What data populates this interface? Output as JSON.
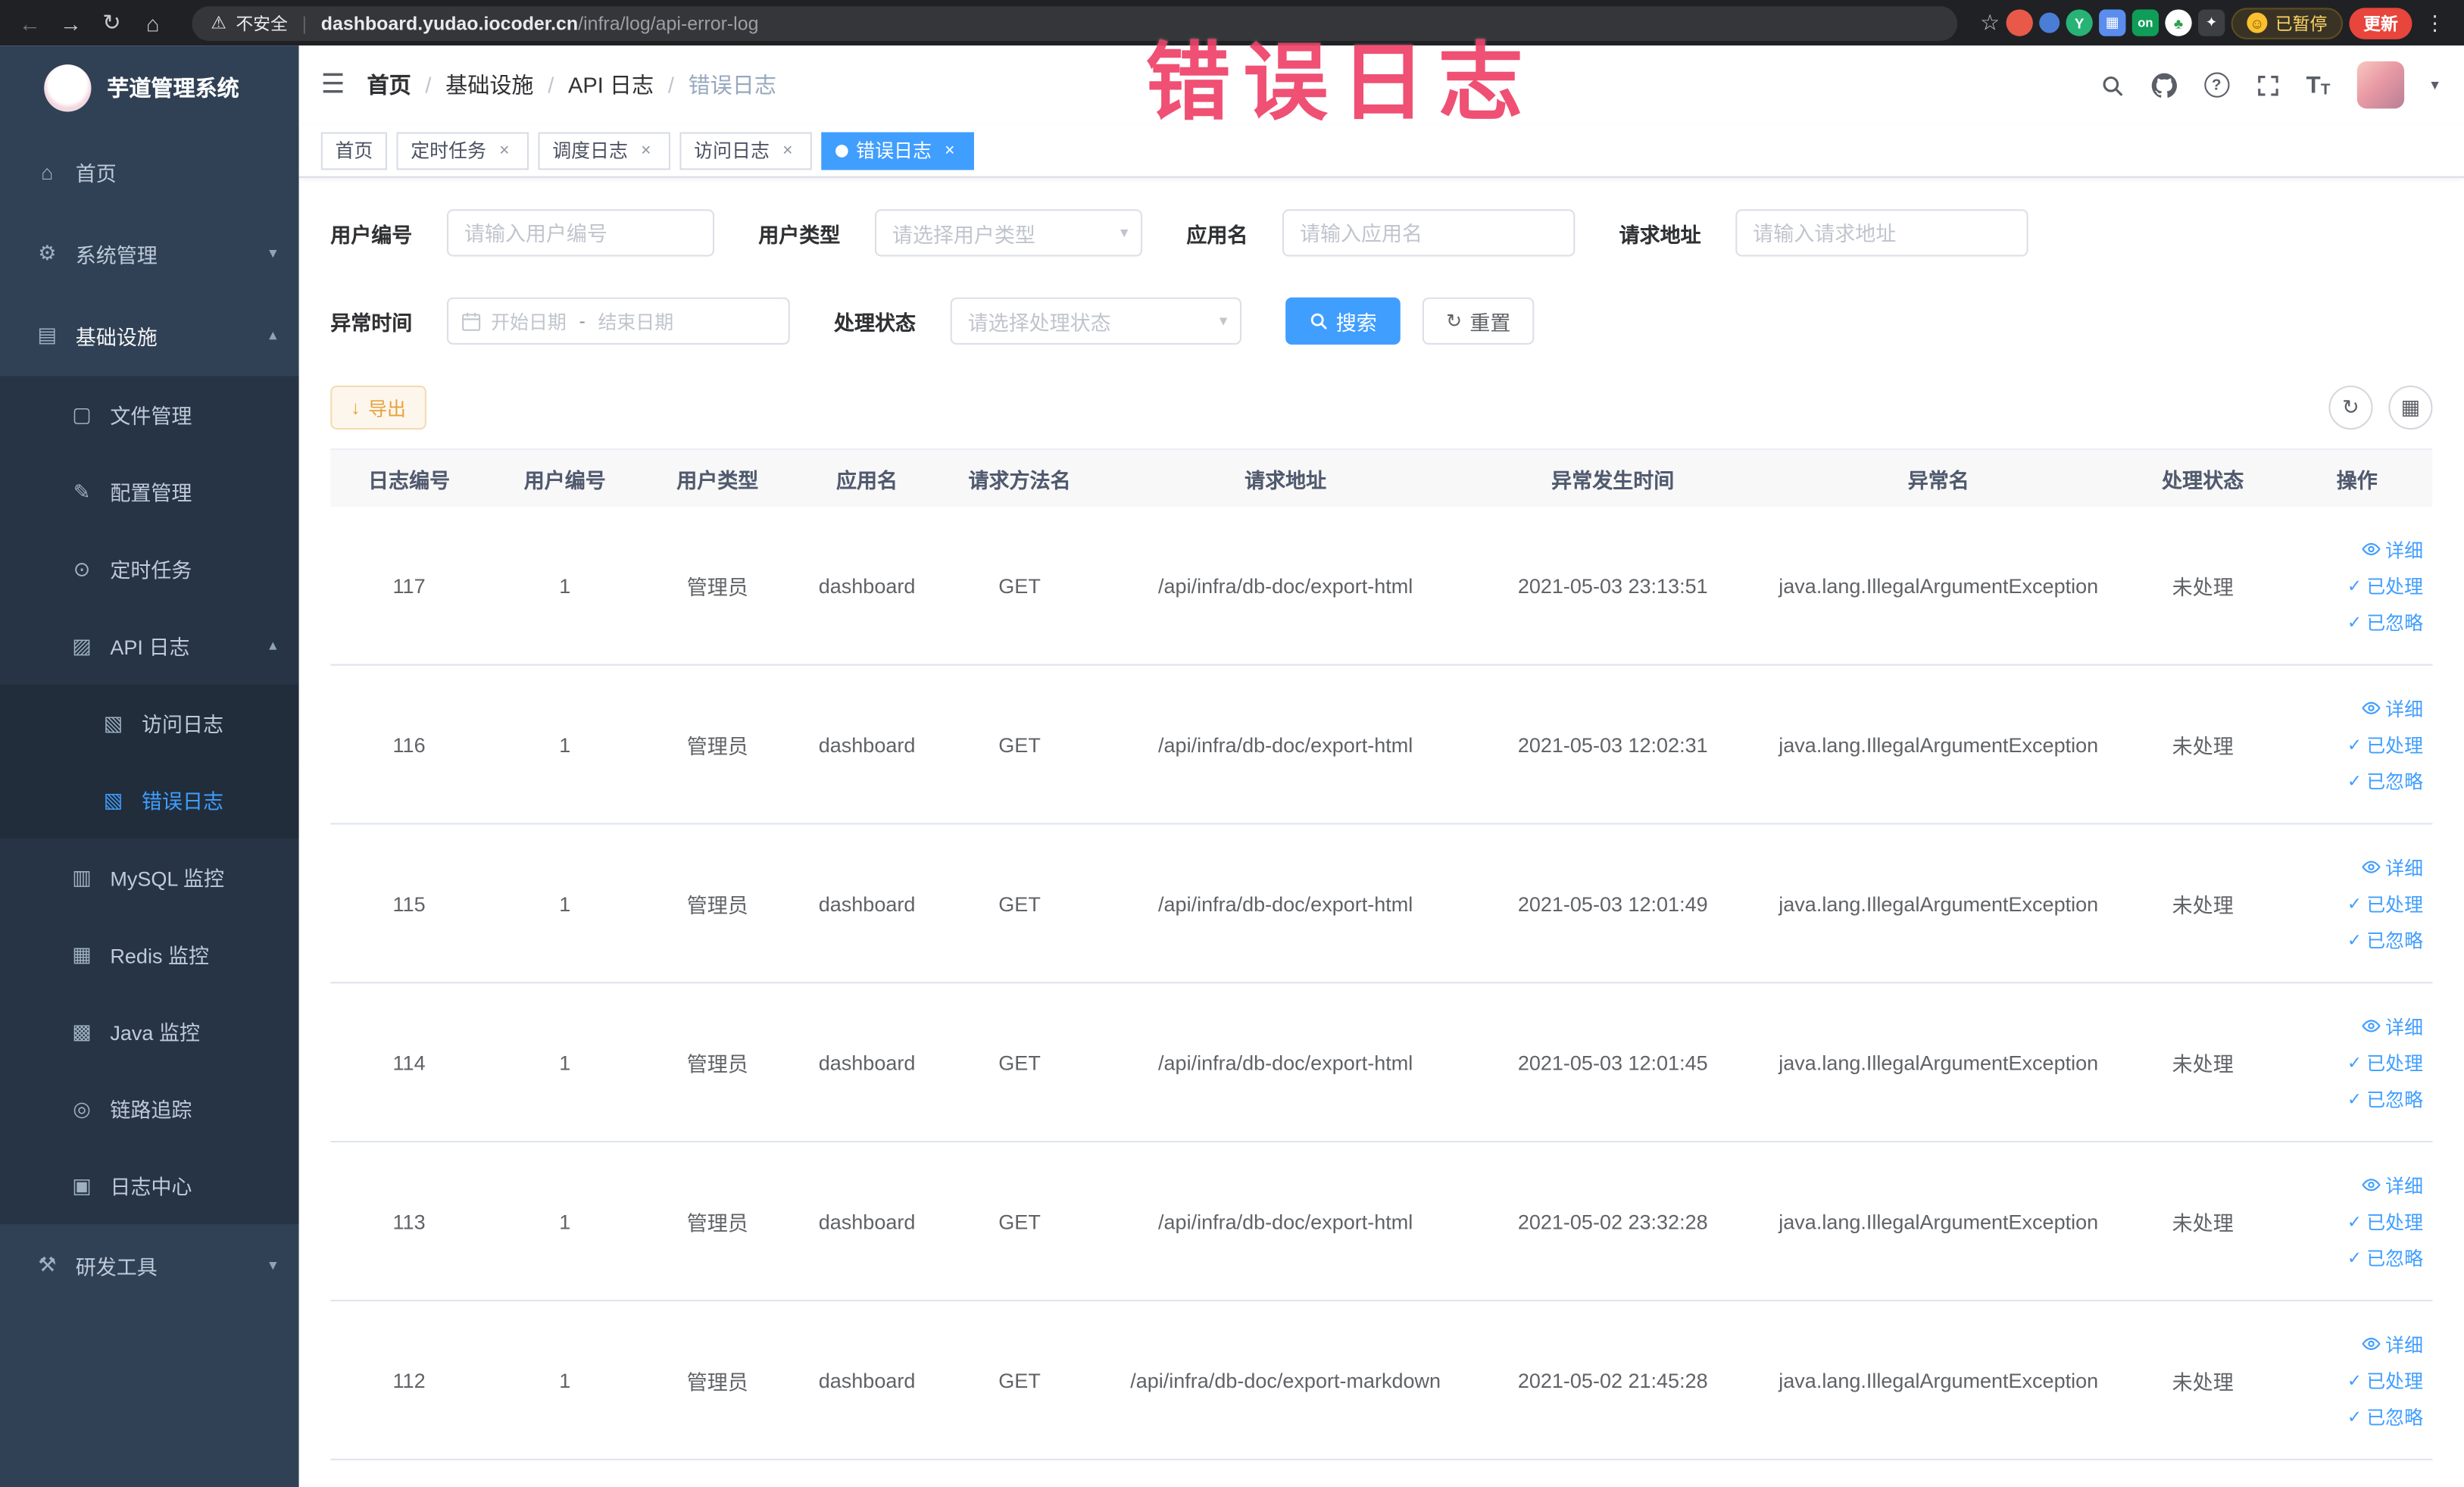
{
  "colors": {
    "accent": "#409eff",
    "sidebar_bg": "#304156",
    "submenu_bg": "#263445",
    "warning": "#e6a23c",
    "update_red": "#e8453c",
    "overlay_pink": "#ee4268",
    "tag_active": "#409eff"
  },
  "browser": {
    "security_label": "不安全",
    "url_host": "dashboard.yudao.iocoder.cn",
    "url_path": "/infra/log/api-error-log",
    "paused_label": "已暂停",
    "update_label": "更新",
    "ext_on_label": "on",
    "ext_y_label": "Y"
  },
  "overlay": {
    "text": "错误日志"
  },
  "sidebar": {
    "logo_title": "芋道管理系统",
    "home": "首页",
    "system": "系统管理",
    "infra": "基础设施",
    "file": "文件管理",
    "config": "配置管理",
    "job": "定时任务",
    "api_log": "API 日志",
    "access_log": "访问日志",
    "error_log": "错误日志",
    "mysql": "MySQL 监控",
    "redis": "Redis 监控",
    "java": "Java 监控",
    "trace": "链路追踪",
    "log_center": "日志中心",
    "dev_tools": "研发工具"
  },
  "breadcrumb": {
    "b1": "首页",
    "b2": "基础设施",
    "b3": "API 日志",
    "b4": "错误日志",
    "sep": "/"
  },
  "tags": {
    "t1": "首页",
    "t2": "定时任务",
    "t3": "调度日志",
    "t4": "访问日志",
    "t5": "错误日志"
  },
  "filters": {
    "user_id_label": "用户编号",
    "user_id_placeholder": "请输入用户编号",
    "user_type_label": "用户类型",
    "user_type_placeholder": "请选择用户类型",
    "app_name_label": "应用名",
    "app_name_placeholder": "请输入应用名",
    "request_url_label": "请求地址",
    "request_url_placeholder": "请输入请求地址",
    "exception_time_label": "异常时间",
    "date_start_placeholder": "开始日期",
    "date_end_placeholder": "结束日期",
    "date_separator": "-",
    "process_status_label": "处理状态",
    "process_status_placeholder": "请选择处理状态",
    "search_button": "搜索",
    "reset_button": "重置"
  },
  "toolbar": {
    "export_button": "导出"
  },
  "table": {
    "columns": [
      "日志编号",
      "用户编号",
      "用户类型",
      "应用名",
      "请求方法名",
      "请求地址",
      "异常发生时间",
      "异常名",
      "处理状态",
      "操作"
    ],
    "actions": {
      "detail": "详细",
      "done": "已处理",
      "ignore": "已忽略"
    },
    "rows": [
      {
        "log_id": "117",
        "user_id": "1",
        "user_type": "管理员",
        "app_name": "dashboard",
        "method": "GET",
        "url": "/api/infra/db-doc/export-html",
        "time": "2021-05-03 23:13:51",
        "exception": "java.lang.IllegalArgumentException",
        "status": "未处理"
      },
      {
        "log_id": "116",
        "user_id": "1",
        "user_type": "管理员",
        "app_name": "dashboard",
        "method": "GET",
        "url": "/api/infra/db-doc/export-html",
        "time": "2021-05-03 12:02:31",
        "exception": "java.lang.IllegalArgumentException",
        "status": "未处理"
      },
      {
        "log_id": "115",
        "user_id": "1",
        "user_type": "管理员",
        "app_name": "dashboard",
        "method": "GET",
        "url": "/api/infra/db-doc/export-html",
        "time": "2021-05-03 12:01:49",
        "exception": "java.lang.IllegalArgumentException",
        "status": "未处理"
      },
      {
        "log_id": "114",
        "user_id": "1",
        "user_type": "管理员",
        "app_name": "dashboard",
        "method": "GET",
        "url": "/api/infra/db-doc/export-html",
        "time": "2021-05-03 12:01:45",
        "exception": "java.lang.IllegalArgumentException",
        "status": "未处理"
      },
      {
        "log_id": "113",
        "user_id": "1",
        "user_type": "管理员",
        "app_name": "dashboard",
        "method": "GET",
        "url": "/api/infra/db-doc/export-html",
        "time": "2021-05-02 23:32:28",
        "exception": "java.lang.IllegalArgumentException",
        "status": "未处理"
      },
      {
        "log_id": "112",
        "user_id": "1",
        "user_type": "管理员",
        "app_name": "dashboard",
        "method": "GET",
        "url": "/api/infra/db-doc/export-markdown",
        "time": "2021-05-02 21:45:28",
        "exception": "java.lang.IllegalArgumentException",
        "status": "未处理"
      }
    ]
  },
  "icons": {
    "back": "←",
    "forward": "→",
    "reload": "↻",
    "browser_home": "⌂",
    "warning": "⚠",
    "star": "☆",
    "kebab": "⋮",
    "hamburger": "☰",
    "caret_down": "▾",
    "chev_down": "▾",
    "chev_up": "▴",
    "close": "×",
    "check": "✓",
    "reset": "↻",
    "export": "↓",
    "refresh": "↻",
    "columns": "▦",
    "question": "?",
    "font_size_big": "T",
    "font_size_small": "T",
    "menu_home": "⌂",
    "menu_system": "⚙",
    "menu_infra": "▤",
    "menu_file": "▢",
    "menu_config": "✎",
    "menu_job": "⊙",
    "menu_api": "▨",
    "menu_access": "▧",
    "menu_error": "▧",
    "menu_mysql": "▥",
    "menu_redis": "▦",
    "menu_java": "▩",
    "menu_trace": "◎",
    "menu_log_center": "▣",
    "menu_dev": "⚒",
    "ext_tree": "♣",
    "ext_dark": "✦",
    "smiley": "☺"
  }
}
